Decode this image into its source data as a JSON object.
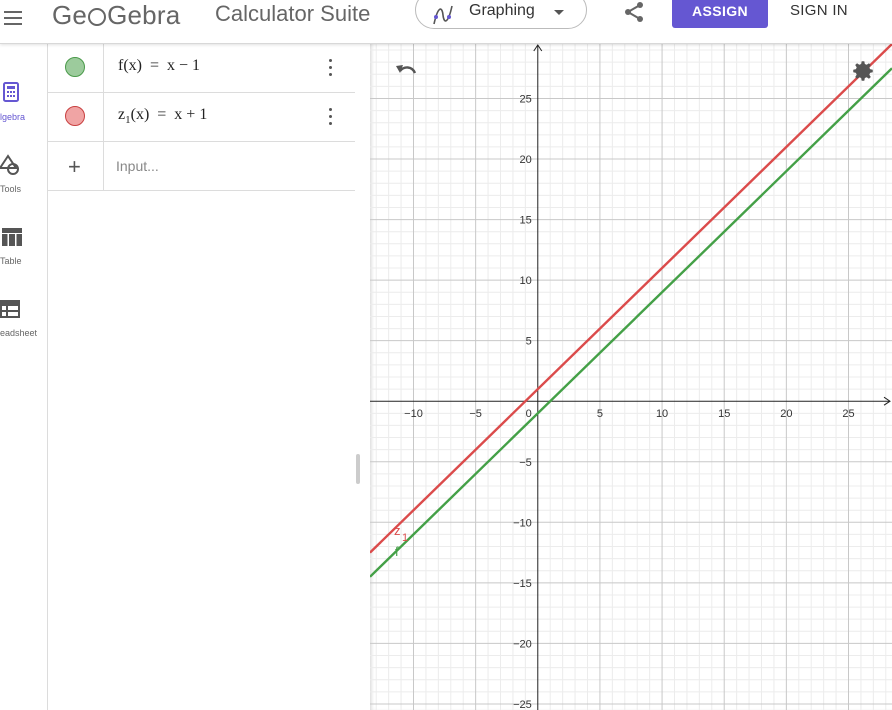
{
  "header": {
    "brand": "GeoGebra",
    "brand_pre": "Ge",
    "brand_post": "Gebra",
    "suite": "Calculator Suite",
    "app_picker": {
      "label": "Graphing",
      "icon": "graphing-icon"
    },
    "assign_label": "ASSIGN",
    "signin_label": "SIGN IN",
    "colors": {
      "assign_bg": "#6557d2",
      "text": "#666666"
    }
  },
  "sidebar": {
    "items": [
      {
        "id": "algebra",
        "label": "lgebra",
        "icon": "calculator-icon",
        "active": true
      },
      {
        "id": "tools",
        "label": "Tools",
        "icon": "shapes-icon",
        "active": false
      },
      {
        "id": "table",
        "label": "Table",
        "icon": "table-icon",
        "active": false
      },
      {
        "id": "spreadsheet",
        "label": "eadsheet",
        "icon": "spreadsheet-icon",
        "active": false
      }
    ]
  },
  "algebra": {
    "rows": [
      {
        "name": "f",
        "formula": "f(x)  =  x − 1",
        "marble_color": "#9ccb9c"
      },
      {
        "name": "z1",
        "formula_pre": "z",
        "formula_sub": "1",
        "formula_post": "(x)  =  x + 1",
        "marble_color": "#f0a4a4"
      }
    ],
    "input_placeholder": "Input..."
  },
  "graph": {
    "colors": {
      "f": "#44a047",
      "z1": "#db4b4b",
      "axis": "#222222",
      "grid_major": "#c8c8c8",
      "grid_minor": "#ececec"
    },
    "curve_labels": {
      "f": "f",
      "z1_main": "z",
      "z1_sub": "1"
    },
    "functions": [
      {
        "name": "f",
        "slope": 1,
        "intercept": -1
      },
      {
        "name": "z1",
        "slope": 1,
        "intercept": 1
      }
    ],
    "x_ticks": [
      "−10",
      "−5",
      "5",
      "10",
      "15",
      "20",
      "25"
    ],
    "y_ticks": [
      "25",
      "20",
      "15",
      "10",
      "5",
      "−5",
      "−10",
      "−15",
      "−20",
      "−25"
    ],
    "origin_label": "0"
  },
  "chart_data": {
    "type": "line",
    "title": "",
    "xlabel": "",
    "ylabel": "",
    "xlim": [
      -13.5,
      28.5
    ],
    "ylim": [
      -25.5,
      29.5
    ],
    "grid": true,
    "series": [
      {
        "name": "f",
        "x": [
          -13.5,
          28.5
        ],
        "y": [
          -14.5,
          27.5
        ]
      },
      {
        "name": "z1",
        "x": [
          -13.5,
          28.5
        ],
        "y": [
          -12.5,
          29.5
        ]
      }
    ]
  }
}
